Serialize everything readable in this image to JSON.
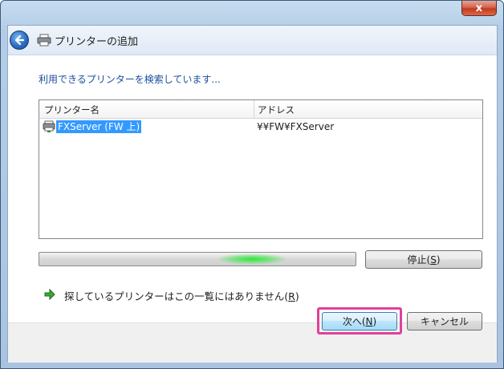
{
  "window": {
    "title": "プリンターの追加",
    "close_label": "x"
  },
  "status": {
    "text": "利用できるプリンターを検索しています..."
  },
  "list": {
    "columns": [
      "プリンター名",
      "アドレス"
    ],
    "rows": [
      {
        "name": "FXServer (FW 上)",
        "address": "¥¥FW¥FXServer"
      }
    ]
  },
  "progress": {
    "state": "searching"
  },
  "buttons": {
    "stop": {
      "label": "停止(",
      "mnemonic": "S",
      "suffix": ")"
    },
    "next": {
      "label": "次へ(",
      "mnemonic": "N",
      "suffix": ")"
    },
    "cancel": {
      "label": "キャンセル"
    }
  },
  "link": {
    "text": "探しているプリンターはこの一覧にはありません(",
    "mnemonic": "R",
    "suffix": ")"
  },
  "colors": {
    "accent": "#1b4f9c",
    "selection": "#3399ff",
    "highlight": "#e0409a",
    "progress_glow": "#2ee83a"
  }
}
